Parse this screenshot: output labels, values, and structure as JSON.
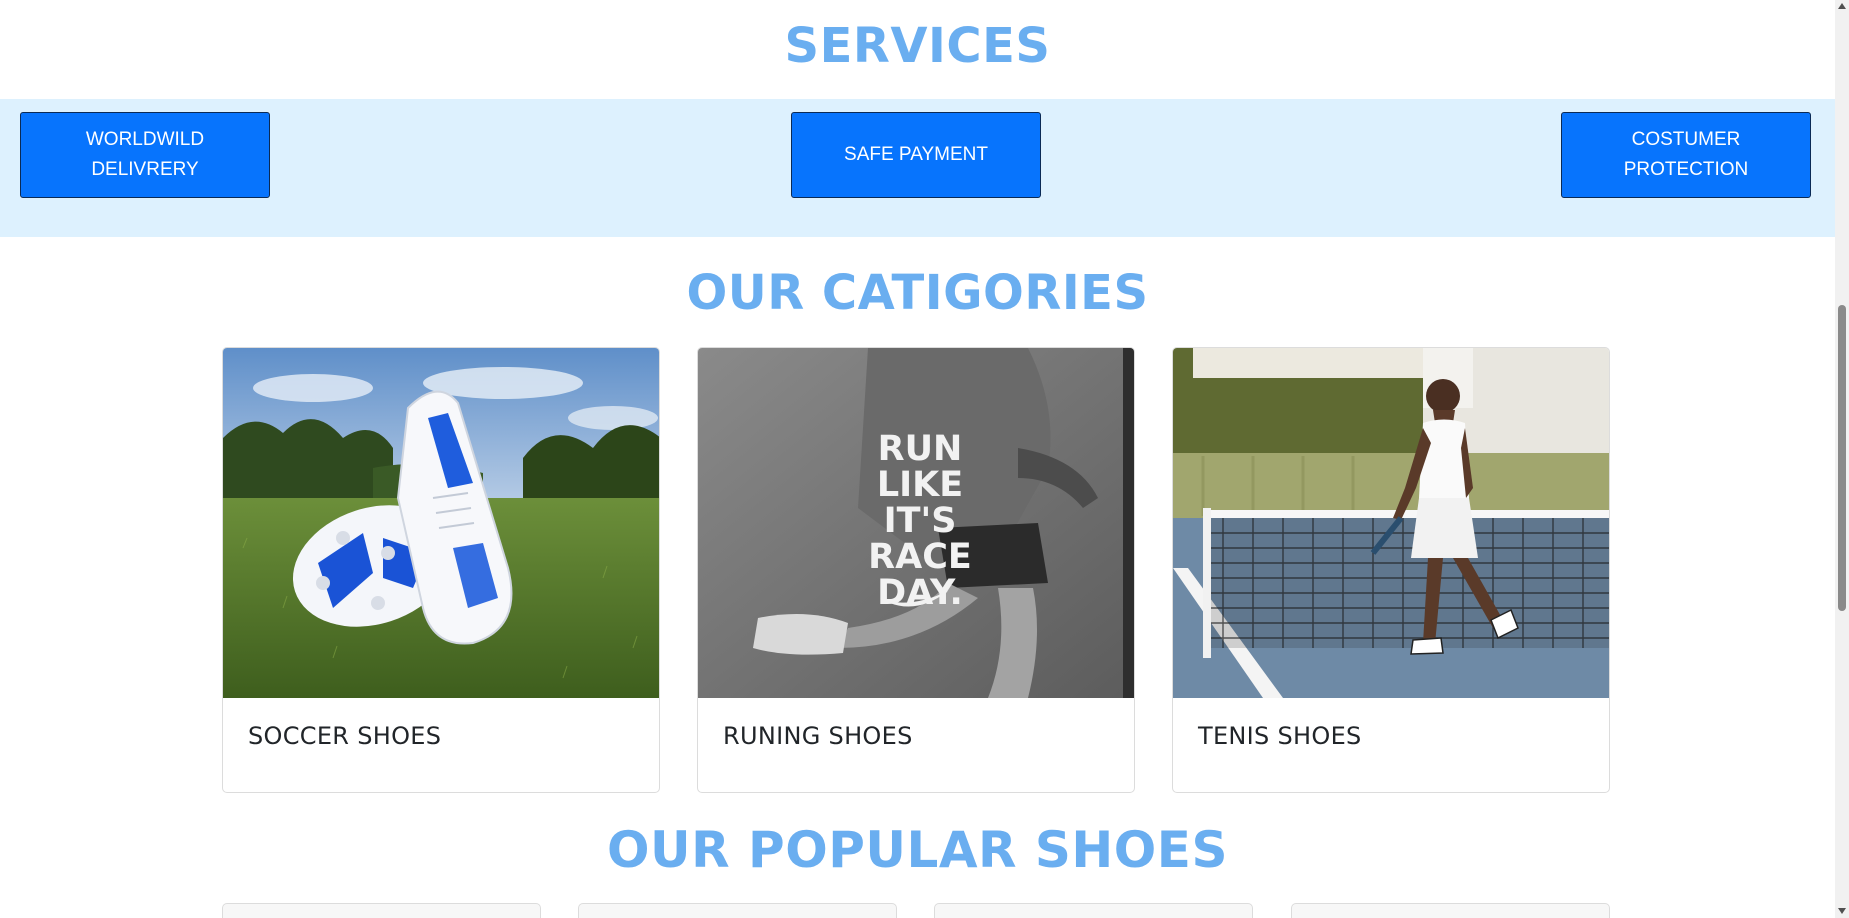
{
  "services": {
    "title": "SERVICES",
    "items": [
      {
        "label": "WORLDWILD DELIVRERY"
      },
      {
        "label": "SAFE PAYMENT"
      },
      {
        "label": "COSTUMER PROTECTION"
      }
    ]
  },
  "categories": {
    "title": "OUR CATIGORIES",
    "items": [
      {
        "label": "SOCCER SHOES",
        "image": "soccer-shoes-image"
      },
      {
        "label": "RUNING SHOES",
        "image": "running-shoes-image",
        "image_text": [
          "RUN",
          "LIKE",
          "IT'S",
          "RACE",
          "DAY."
        ]
      },
      {
        "label": "TENIS SHOES",
        "image": "tennis-shoes-image"
      }
    ]
  },
  "popular": {
    "title": "OUR POPULAR SHOES"
  },
  "colors": {
    "heading": "#6aaef0",
    "services_band": "#ddf1fe",
    "button": "#0774fd"
  }
}
